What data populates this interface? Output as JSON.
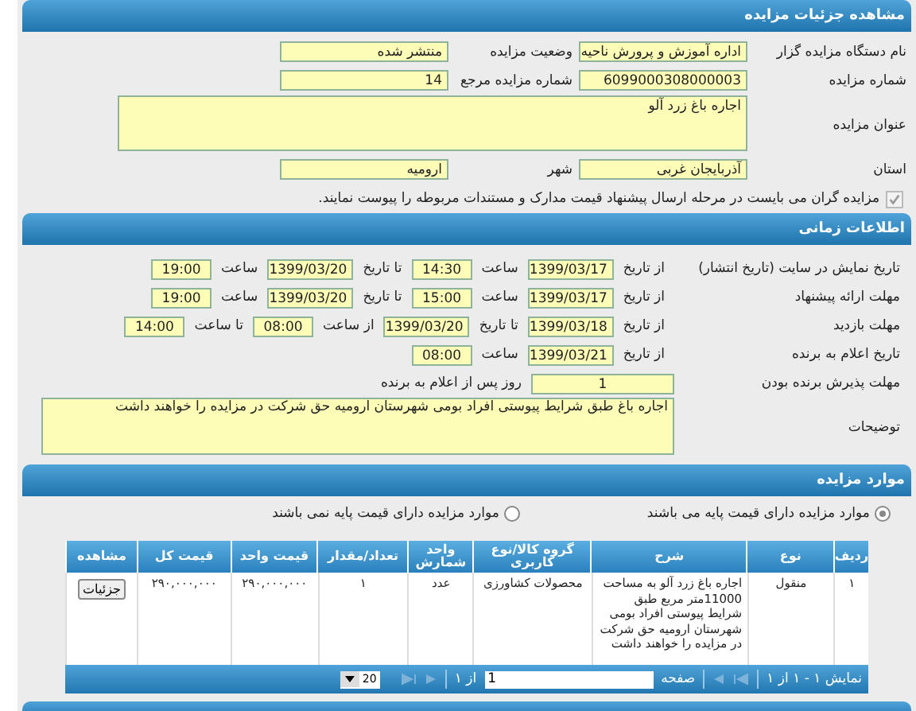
{
  "header": {
    "title": "مشاهده جزئیات مزایده"
  },
  "general": {
    "rows": [
      {
        "kind": "pair",
        "right": {
          "label": "نام دستگاه مزایده گزار",
          "value": "اداره آموزش و پرورش ناحیه"
        },
        "left": {
          "label": "وضعیت مزایده",
          "value": "منتشر شده"
        }
      },
      {
        "kind": "pair",
        "right": {
          "label": "شماره مزایده",
          "value": "6099000308000003"
        },
        "left": {
          "label": "شماره مزایده مرجع",
          "value": "14"
        }
      },
      {
        "kind": "area",
        "right": {
          "label": "عنوان مزایده",
          "value": "اجاره باغ زرد آلو"
        }
      },
      {
        "kind": "pair",
        "right": {
          "label": "استان",
          "value": "آذربایجان غربی"
        },
        "left": {
          "label": "شهر",
          "value": "ارومیه"
        }
      }
    ],
    "attachment_check": {
      "checked": true,
      "disabled": true,
      "label": "مزایده گران می بایست در مرحله ارسال پیشنهاد قیمت مدارک و مستندات مربوطه را پیوست نمایند."
    }
  },
  "time_section": {
    "title": "اطلاعات زمانی",
    "rows": [
      {
        "label": "تاریخ نمایش در سایت (تاریخ انتشار)",
        "parts": [
          {
            "kind": "text",
            "text": "از تاریخ"
          },
          {
            "kind": "date",
            "value": "1399/03/17"
          },
          {
            "kind": "text",
            "text": "ساعت"
          },
          {
            "kind": "time",
            "value": "14:30"
          },
          {
            "kind": "text",
            "text": "تا تاریخ"
          },
          {
            "kind": "date",
            "value": "1399/03/20"
          },
          {
            "kind": "text",
            "text": "ساعت"
          },
          {
            "kind": "time",
            "value": "19:00"
          }
        ]
      },
      {
        "label": "مهلت ارائه پیشنهاد",
        "parts": [
          {
            "kind": "text",
            "text": "از تاریخ"
          },
          {
            "kind": "date",
            "value": "1399/03/17"
          },
          {
            "kind": "text",
            "text": "ساعت"
          },
          {
            "kind": "time",
            "value": "15:00"
          },
          {
            "kind": "text",
            "text": "تا تاریخ"
          },
          {
            "kind": "date",
            "value": "1399/03/20"
          },
          {
            "kind": "text",
            "text": "ساعت"
          },
          {
            "kind": "time",
            "value": "19:00"
          }
        ]
      },
      {
        "label": "مهلت بازدید",
        "parts": [
          {
            "kind": "text",
            "text": "از تاریخ"
          },
          {
            "kind": "date",
            "value": "1399/03/18"
          },
          {
            "kind": "text",
            "text": "تا تاریخ"
          },
          {
            "kind": "date",
            "value": "1399/03/20"
          },
          {
            "kind": "text",
            "text": "از ساعت"
          },
          {
            "kind": "time",
            "value": "08:00"
          },
          {
            "kind": "text",
            "text": "تا ساعت"
          },
          {
            "kind": "time",
            "value": "14:00"
          }
        ]
      },
      {
        "label": "تاریخ اعلام به برنده",
        "parts": [
          {
            "kind": "text",
            "text": "از تاریخ"
          },
          {
            "kind": "date",
            "value": "1399/03/21"
          },
          {
            "kind": "text",
            "text": "ساعت"
          },
          {
            "kind": "time",
            "value": "08:00"
          }
        ]
      },
      {
        "label": "مهلت پذیرش برنده بودن",
        "parts": [
          {
            "kind": "days",
            "value": "1"
          },
          {
            "kind": "text",
            "text": "روز پس از اعلام به برنده"
          }
        ]
      }
    ],
    "notes": {
      "label": "توضیحات",
      "value": "اجاره باغ طبق شرایط پیوستی افراد بومی شهرستان ارومیه حق شرکت در مزایده را خواهند داشت"
    }
  },
  "items_section": {
    "title": "موارد مزایده",
    "radios": [
      {
        "label": "موارد مزایده دارای قیمت پایه می باشند",
        "selected": true
      },
      {
        "label": "موارد مزایده دارای قیمت پایه نمی باشند",
        "selected": false
      }
    ],
    "table": {
      "columns": [
        "ردیف",
        "نوع",
        "شرح",
        "گروه کالا/نوع کاربری",
        "واحد شمارش",
        "تعداد/مقدار",
        "قیمت واحد",
        "قیمت کل",
        "مشاهده"
      ],
      "rows": [
        {
          "cells": [
            "۱",
            "منقول",
            "اجاره باغ زرد آلو به مساحت 11000متر مربع طبق شرایط پیوستی افراد بومی شهرستان ارومیه حق شرکت در مزایده را خواهند داشت",
            "محصولات کشاورزی",
            "عدد",
            "۱",
            "۲۹۰,۰۰۰,۰۰۰",
            "۲۹۰,۰۰۰,۰۰۰"
          ],
          "action": "جزئیات"
        }
      ]
    },
    "pager": {
      "summary": "نمایش ۱ - ۱ از ۱",
      "page_label": "صفحه",
      "page": "1",
      "of": "از ۱",
      "page_size": "20"
    }
  }
}
